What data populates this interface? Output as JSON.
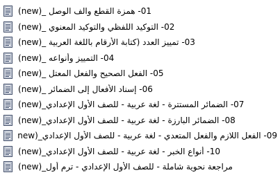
{
  "file_list": {
    "icon": "document-icon",
    "items": [
      {
        "label": "01- همزة القطع والف الوصل _(new)"
      },
      {
        "label": "02- التوكيد اللفظي والتوكيد المعنوي _(new)"
      },
      {
        "label": "03- تمييز العدد (كتابة الأرقام باللغة العربية _(new)"
      },
      {
        "label": "04- التمييز وأنواعه _(new)"
      },
      {
        "label": "05- الفعل الصحيح والفعل المعتل _(new)"
      },
      {
        "label": "06- إسناد الأفعال إلى الضمائر _(new)"
      },
      {
        "label": "07- الضمائر المستترة - لغة عربية - للصف الأول الإعدادي_(new)"
      },
      {
        "label": "08- الضمائر البارزة - لغة عربية - للصف الأول الإعدادي_(new)"
      },
      {
        "label": "09- الفعل اللازم والفعل المتعدي - لغة عربية - للصف الأول الإعدادي_(new)"
      },
      {
        "label": "10- أنواع الخبر - لغة عربية - للصف الأول الإعدادي_(new)"
      },
      {
        "label": "مراجعة نحوية شاملة - للصف الأول الإعدادي - ترم أول_(new)"
      }
    ]
  }
}
